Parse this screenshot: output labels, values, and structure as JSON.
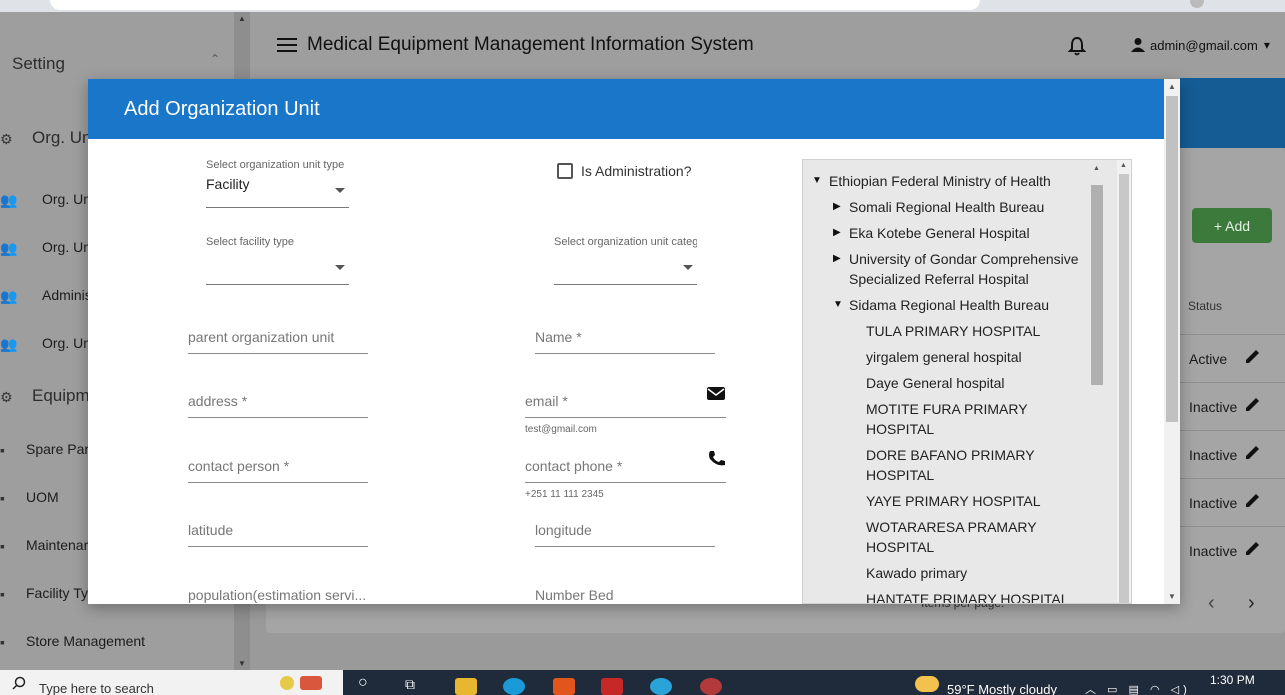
{
  "app": {
    "title": "Medical Equipment Management Information System",
    "user_email": "admin@gmail.com"
  },
  "sidebar": {
    "setting_label": "Setting",
    "org_unit_header": "Org. Unit",
    "items": [
      {
        "label": "Org. Un",
        "icon": "group-icon"
      },
      {
        "label": "Org. Un",
        "icon": "group-icon"
      },
      {
        "label": "Adminis",
        "icon": "group-icon"
      },
      {
        "label": "Org. Un",
        "icon": "group-icon"
      }
    ],
    "equipment_header": "Equipme",
    "equipment_items": [
      "Spare Par",
      "UOM",
      "Maintenar",
      "Facility Ty",
      "Store Management"
    ]
  },
  "background": {
    "add_label": "+ Add",
    "status_header": "Status",
    "rows": [
      "Active",
      "Inactive",
      "Inactive",
      "Inactive",
      "Inactive"
    ],
    "items_per_page": "Items per page:"
  },
  "modal": {
    "title": "Add Organization Unit",
    "org_type": {
      "label": "Select organization unit type",
      "value": "Facility"
    },
    "is_admin_label": "Is Administration?",
    "facility_type": {
      "label": "Select facility type",
      "value": ""
    },
    "org_category": {
      "label": "Select organization unit catego",
      "value": ""
    },
    "fields": {
      "parent": "parent organization unit",
      "name": "Name *",
      "address": "address *",
      "email": "email *",
      "email_hint": "test@gmail.com",
      "contact_person": "contact person *",
      "contact_phone": "contact phone *",
      "phone_hint": "+251 11 111 2345",
      "latitude": "latitude",
      "longitude": "longitude",
      "population": "population(estimation servi...",
      "number_bed": "Number Bed"
    },
    "tree": {
      "root": "Ethiopian Federal Ministry of Health",
      "children": [
        {
          "label": "Somali Regional Health Bureau",
          "expanded": false
        },
        {
          "label": "Eka Kotebe General Hospital",
          "expanded": false
        },
        {
          "label_line1": "University of Gondar Comprehensive",
          "label_line2": "Specialized Referral Hospital",
          "expanded": false
        },
        {
          "label": "Sidama Regional Health Bureau",
          "expanded": true
        }
      ],
      "sidama_children": [
        "TULA PRIMARY HOSPITAL",
        "yirgalem general hospital",
        "Daye General hospital",
        "MOTITE FURA PRIMARY",
        "HOSPITAL",
        "DORE BAFANO PRIMARY",
        "HOSPITAL",
        "YAYE PRIMARY HOSPITAL",
        "WOTARARESA PRAMARY",
        "HOSPITAL",
        "Kawado primary",
        "HANTATE PRIMARY HOSPITAL"
      ]
    }
  },
  "taskbar": {
    "search_placeholder": "Type here to search",
    "weather": "59°F  Mostly cloudy",
    "time": "1:30 PM"
  },
  "colors": {
    "modal_header": "#1976c8",
    "add_button": "#3b7a3b",
    "taskbar": "#1f2a3a"
  }
}
